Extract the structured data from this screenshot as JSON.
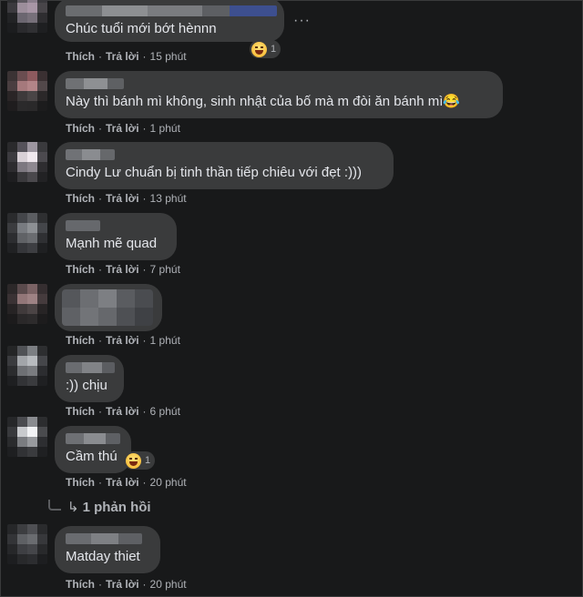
{
  "labels": {
    "like": "Thích",
    "reply": "Trả lời",
    "dot": "·"
  },
  "comments": [
    {
      "text": "Chúc tuổi mới bớt hènnn",
      "time": "15 phút",
      "reaction_count": "1",
      "reaction_icon": "laughing-emoji-icon"
    },
    {
      "text": "Này thì bánh mì không, sinh nhật của bố mà m đòi ăn bánh mì😂",
      "time": "1 phút"
    },
    {
      "text": "Cindy Lư chuẩn bị tinh thần tiếp chiêu với đẹt :)))",
      "time": "13 phút"
    },
    {
      "text": "Mạnh mẽ quad",
      "time": "7 phút"
    },
    {
      "text": "",
      "time": "1 phút"
    },
    {
      "text": ":)) chịu",
      "time": "6 phút"
    },
    {
      "text": "Cầm thú",
      "time": "20 phút",
      "reaction_count": "1",
      "reaction_icon": "laughing-emoji-icon"
    },
    {
      "text": "Matday thiet",
      "time": "20 phút"
    }
  ],
  "replies_link": "1 phản hồi",
  "more_menu": "···",
  "colors": {
    "background": "#18191a",
    "bubble": "#3a3b3c",
    "text": "#e4e6eb",
    "secondary_text": "#b0b3b8"
  }
}
